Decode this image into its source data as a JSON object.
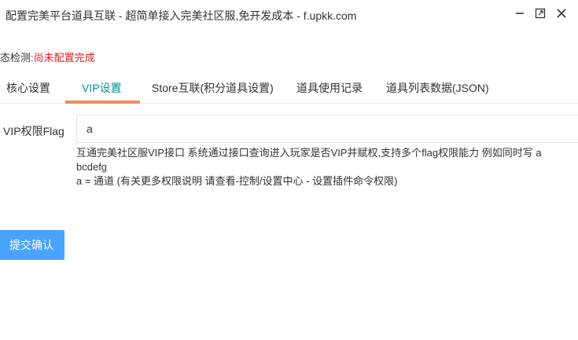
{
  "window": {
    "title": "配置完美平台道具互联 - 超简单接入完美社区服,免开发成本 - f.upkk.com",
    "icons": [
      "minimize-icon",
      "maximize-icon",
      "close-icon"
    ]
  },
  "status": {
    "label": "态检测:",
    "value": "尚未配置完成",
    "value_color": "#e02020"
  },
  "tabs": [
    {
      "label": "核心设置",
      "active": false
    },
    {
      "label": "VIP设置",
      "active": true
    },
    {
      "label": "Store互联(积分道具设置)",
      "active": false
    },
    {
      "label": "道具使用记录",
      "active": false
    },
    {
      "label": "道具列表数据(JSON)",
      "active": false
    }
  ],
  "form": {
    "flag_label": "VIP权限Flag",
    "flag_value": "a",
    "help_line1": "互通完美社区服VIP接口 系统通过接口查询进入玩家是否VIP并赋权,支持多个flag权限能力 例如同时写 a",
    "help_line2": "bcdefg",
    "help_line3": "a = 通道 (有关更多权限说明 请查看-控制/设置中心 - 设置插件命令权限)",
    "submit_label": "提交确认"
  },
  "colors": {
    "accent": "#009688",
    "tab_underline": "#ef8c5a",
    "button": "#4aa3ff"
  }
}
